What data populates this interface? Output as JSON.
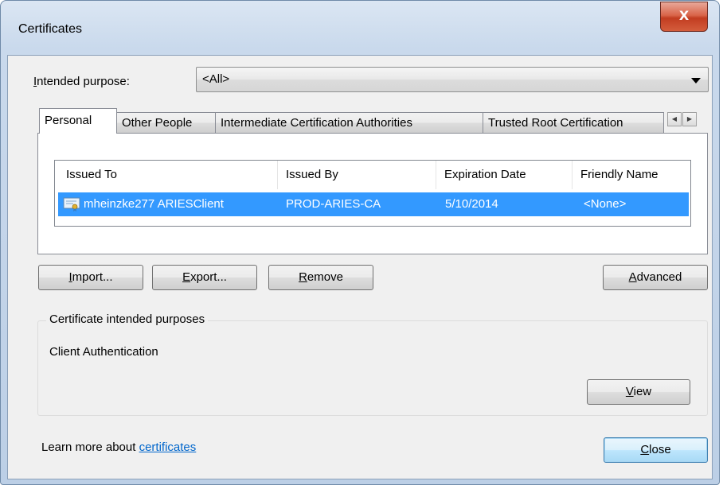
{
  "window": {
    "title": "Certificates",
    "close_glyph": "X"
  },
  "intended_purpose": {
    "label_prefix": "I",
    "label_rest": "ntended purpose:",
    "value": "<All>"
  },
  "tabs": [
    {
      "label": "Personal",
      "active": true
    },
    {
      "label": "Other People",
      "active": false
    },
    {
      "label": "Intermediate Certification Authorities",
      "active": false
    },
    {
      "label": "Trusted Root Certification",
      "active": false
    }
  ],
  "tab_scroll": {
    "left": "◀",
    "right": "▶"
  },
  "cert_list": {
    "columns": [
      "Issued To",
      "Issued By",
      "Expiration Date",
      "Friendly Name"
    ],
    "rows": [
      {
        "icon": "certificate-icon",
        "issued_to": "mheinzke277 ARIESClient",
        "issued_by": "PROD-ARIES-CA",
        "expiration": "5/10/2014",
        "friendly_name": "<None>",
        "selected": true
      }
    ]
  },
  "buttons": {
    "import": {
      "accel": "I",
      "rest": "mport..."
    },
    "export": {
      "accel": "E",
      "rest": "xport..."
    },
    "remove": {
      "accel": "R",
      "rest": "emove"
    },
    "advanced": {
      "accel": "A",
      "rest": "dvanced"
    },
    "view": {
      "accel": "V",
      "rest": "iew"
    },
    "close": {
      "accel": "C",
      "rest": "lose"
    }
  },
  "purposes_group": {
    "title": "Certificate intended purposes",
    "text": "Client Authentication"
  },
  "footer": {
    "learn_text": "Learn more about ",
    "link_text": "certificates"
  },
  "colors": {
    "selection": "#3399ff",
    "link": "#0066cc",
    "close_button": "#c23d21"
  }
}
